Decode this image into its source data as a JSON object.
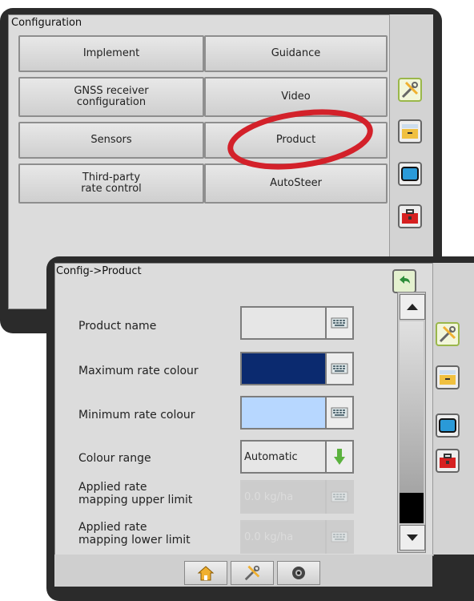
{
  "config": {
    "title": "Configuration",
    "buttons": {
      "implement": "Implement",
      "guidance": "Guidance",
      "gnss": "GNSS receiver\nconfiguration",
      "video": "Video",
      "sensors": "Sensors",
      "product": "Product",
      "third_party": "Third-party\nrate control",
      "autosteer": "AutoSteer"
    }
  },
  "product": {
    "breadcrumb": "Config->Product",
    "rows": {
      "product_name": "Product name",
      "max_colour": "Maximum rate colour",
      "min_colour": "Minimum rate colour",
      "colour_range": "Colour range",
      "upper_limit": "Applied rate\nmapping upper limit",
      "lower_limit": "Applied rate\nmapping lower limit"
    },
    "values": {
      "colour_range": "Automatic",
      "upper_limit": "0.0 kg/ha",
      "lower_limit": "0.0 kg/ha"
    },
    "colors": {
      "max_colour": "#0b2a6f",
      "min_colour": "#b7d7ff",
      "highlight": "#d3212a"
    }
  },
  "icons": {
    "sidebar": [
      "wrench-screwdriver-icon",
      "drawer-icon",
      "display-icon",
      "toolbox-icon"
    ],
    "nav": [
      "home-icon",
      "wrench-screwdriver-icon",
      "camera-icon"
    ]
  }
}
